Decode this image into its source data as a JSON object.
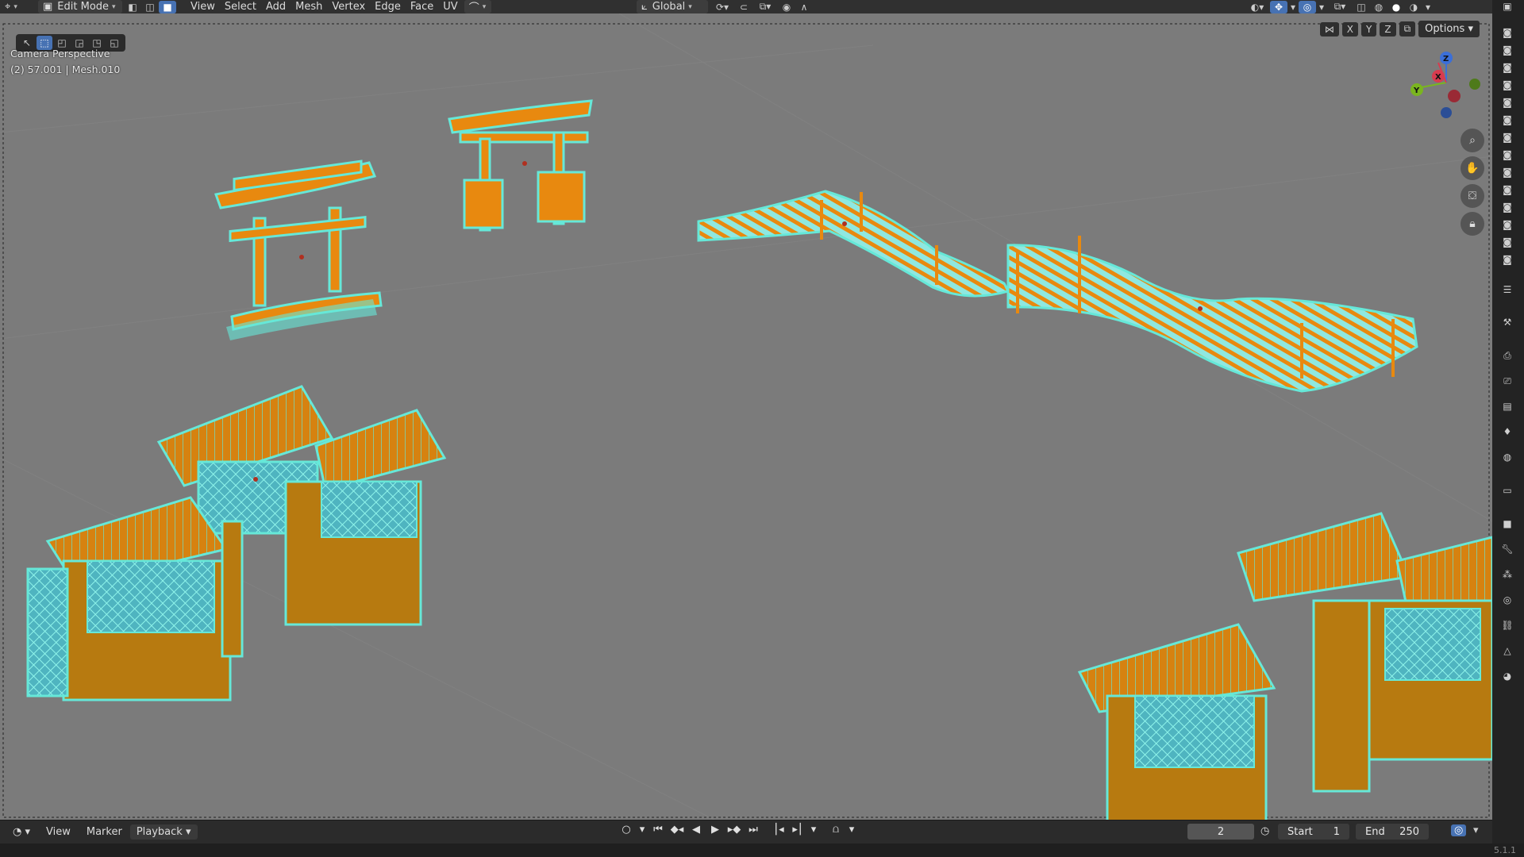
{
  "header": {
    "editor_type_icon": "3d-viewport-icon",
    "mode": "Edit Mode",
    "menus": [
      "View",
      "Select",
      "Add",
      "Mesh",
      "Vertex",
      "Edge",
      "Face",
      "UV"
    ],
    "transform_orientation": "Global"
  },
  "viewport": {
    "camera_label": "Camera Perspective",
    "object_info": "(2) 57.001 | Mesh.010",
    "options_label": "Options",
    "axis_x": "X",
    "axis_y": "Y",
    "axis_z": "Z",
    "gizmo": {
      "x": "X",
      "y": "Y",
      "z": "Z"
    },
    "colors": {
      "background": "#7a7a7a",
      "wire": "#66e8d8",
      "face": "#e8890f"
    }
  },
  "timeline": {
    "menus": [
      "View",
      "Marker"
    ],
    "playback_label": "Playback",
    "current_frame": "2",
    "start_label": "Start",
    "start_value": "1",
    "end_label": "End",
    "end_value": "250"
  },
  "status": {
    "version": "5.1.1"
  }
}
